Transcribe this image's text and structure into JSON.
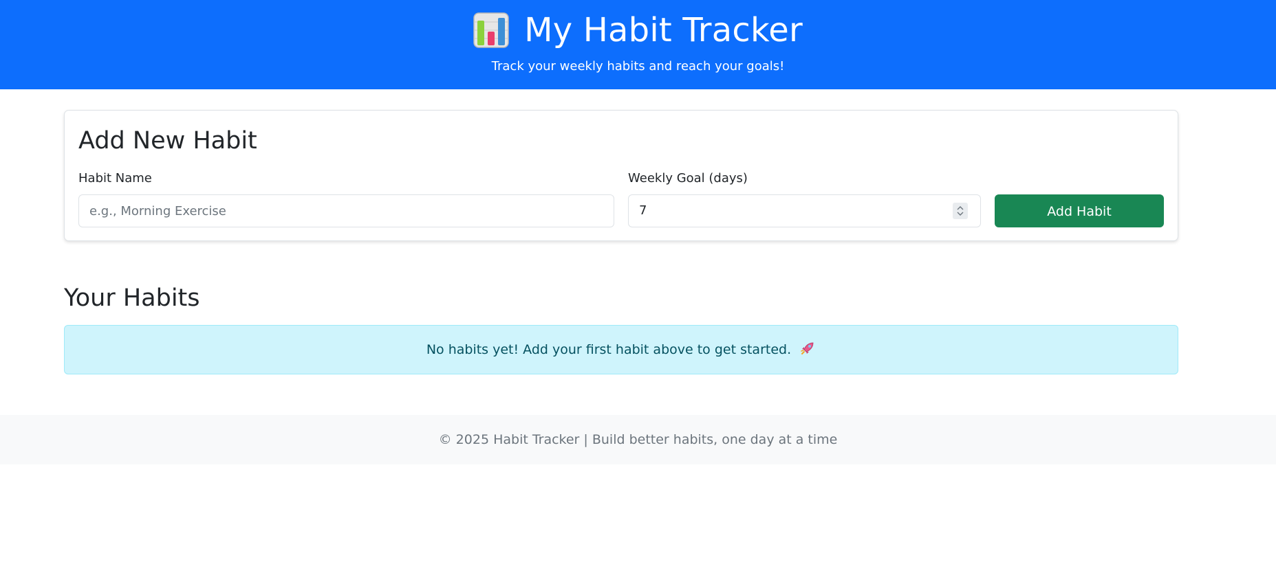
{
  "header": {
    "title": "My Habit Tracker",
    "subtitle": "Track your weekly habits and reach your goals!",
    "icon": "bar-chart-icon",
    "background_color": "#0d6efd"
  },
  "add_habit_form": {
    "title": "Add New Habit",
    "habit_name_label": "Habit Name",
    "habit_name_placeholder": "e.g., Morning Exercise",
    "habit_name_value": "",
    "weekly_goal_label": "Weekly Goal (days)",
    "weekly_goal_value": "7",
    "submit_label": "Add Habit",
    "submit_color": "#198754"
  },
  "habits_section": {
    "title": "Your Habits",
    "empty_message": "No habits yet! Add your first habit above to get started.",
    "empty_icon": "rocket-icon",
    "alert_color": "#cff4fc"
  },
  "footer": {
    "text": "© 2025 Habit Tracker | Build better habits, one day at a time"
  }
}
